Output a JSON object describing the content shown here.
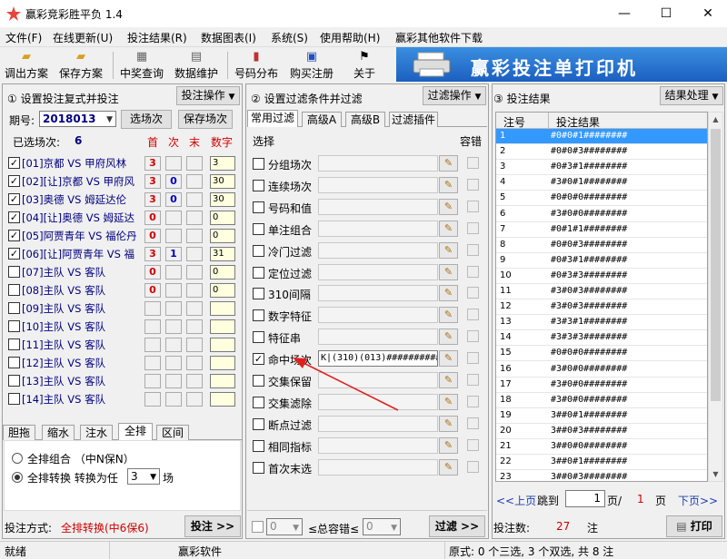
{
  "window": {
    "title": "赢彩竞彩胜平负 1.4",
    "minimize": "—",
    "maximize": "☐",
    "close": "✕"
  },
  "menu": [
    "文件(F)",
    "在线更新(U)",
    "投注结果(R)",
    "数据图表(I)",
    "系统(S)",
    "使用帮助(H)",
    "赢彩其他软件下载"
  ],
  "toolbar": [
    "调出方案",
    "保存方案",
    "中奖查询",
    "数据维护",
    "号码分布",
    "购买注册",
    "关于"
  ],
  "banner": "赢彩投注单打印机",
  "left": {
    "header": "① 设置投注复式并投注",
    "op_button": "投注操作",
    "period_label": "期号:",
    "period_value": "2018013",
    "select_btn": "选场次",
    "save_btn": "保存场次",
    "selected_label": "已选场次:",
    "selected_count": "6",
    "col_first": "首",
    "col_second": "次",
    "col_last": "末",
    "col_num": "数字",
    "matches": [
      {
        "label": "[01]京都 VS 甲府风林",
        "checked": true,
        "first": "3",
        "second": "",
        "last": "",
        "num": "3"
      },
      {
        "label": "[02][让]京都 VS 甲府风",
        "checked": true,
        "first": "3",
        "second": "0",
        "last": "",
        "num": "30"
      },
      {
        "label": "[03]奥德 VS 姆延达伦",
        "checked": true,
        "first": "3",
        "second": "0",
        "last": "",
        "num": "30"
      },
      {
        "label": "[04][让]奥德 VS 姆延达",
        "checked": true,
        "first": "0",
        "second": "",
        "last": "",
        "num": "0"
      },
      {
        "label": "[05]阿贾青年 VS 福伦丹",
        "checked": true,
        "first": "0",
        "second": "",
        "last": "",
        "num": "0"
      },
      {
        "label": "[06][让]阿贾青年 VS 福",
        "checked": true,
        "first": "3",
        "second": "1",
        "last": "",
        "num": "31"
      },
      {
        "label": "[07]主队 VS 客队",
        "checked": false,
        "first": "0",
        "second": "",
        "last": "",
        "num": "0"
      },
      {
        "label": "[08]主队 VS 客队",
        "checked": false,
        "first": "0",
        "second": "",
        "last": "",
        "num": "0"
      },
      {
        "label": "[09]主队 VS 客队",
        "checked": false,
        "first": "",
        "second": "",
        "last": "",
        "num": ""
      },
      {
        "label": "[10]主队 VS 客队",
        "checked": false,
        "first": "",
        "second": "",
        "last": "",
        "num": ""
      },
      {
        "label": "[11]主队 VS 客队",
        "checked": false,
        "first": "",
        "second": "",
        "last": "",
        "num": ""
      },
      {
        "label": "[12]主队 VS 客队",
        "checked": false,
        "first": "",
        "second": "",
        "last": "",
        "num": ""
      },
      {
        "label": "[13]主队 VS 客队",
        "checked": false,
        "first": "",
        "second": "",
        "last": "",
        "num": ""
      },
      {
        "label": "[14]主队 VS 客队",
        "checked": false,
        "first": "",
        "second": "",
        "last": "",
        "num": ""
      }
    ],
    "bottom_tabs": [
      "胆拖",
      "缩水",
      "注水",
      "全排",
      "区间"
    ],
    "radio1": "全排组合 （中N保N）",
    "radio2": "全排转换 转换为任",
    "radio2_value": "3",
    "radio2_suffix": "场",
    "mode_label": "投注方式:",
    "mode_value": "全排转换(中6保6)",
    "submit_btn": "投注 >>"
  },
  "mid": {
    "header": "② 设置过滤条件并过滤",
    "op_button": "过滤操作",
    "tabs": [
      "常用过滤",
      "高级A",
      "高级B",
      "过滤插件"
    ],
    "col_select": "选择",
    "col_tolerance": "容错",
    "filters": [
      {
        "label": "分组场次",
        "checked": false,
        "value": ""
      },
      {
        "label": "连续场次",
        "checked": false,
        "value": ""
      },
      {
        "label": "号码和值",
        "checked": false,
        "value": ""
      },
      {
        "label": "单注组合",
        "checked": false,
        "value": ""
      },
      {
        "label": "冷门过滤",
        "checked": false,
        "value": ""
      },
      {
        "label": "定位过滤",
        "checked": false,
        "value": ""
      },
      {
        "label": "310间隔",
        "checked": false,
        "value": ""
      },
      {
        "label": "数字特征",
        "checked": false,
        "value": ""
      },
      {
        "label": "特征串",
        "checked": false,
        "value": ""
      },
      {
        "label": "命中场次",
        "checked": true,
        "value": "K|(310)(013)##########"
      },
      {
        "label": "交集保留",
        "checked": false,
        "value": ""
      },
      {
        "label": "交集滤除",
        "checked": false,
        "value": ""
      },
      {
        "label": "断点过滤",
        "checked": false,
        "value": ""
      },
      {
        "label": "相同指标",
        "checked": false,
        "value": ""
      },
      {
        "label": "首次末选",
        "checked": false,
        "value": ""
      }
    ],
    "min_value": "0",
    "tol_label": "≤总容错≤",
    "max_value": "0",
    "filter_btn": "过滤 >>"
  },
  "right": {
    "header": "③ 投注结果",
    "op_button": "结果处理",
    "col_no": "注号",
    "col_result": "投注结果",
    "rows": [
      [
        "1",
        "#0#0#1########"
      ],
      [
        "2",
        "#0#0#3########"
      ],
      [
        "3",
        "#0#3#1########"
      ],
      [
        "4",
        "#3#0#1########"
      ],
      [
        "5",
        "#0#0#0########"
      ],
      [
        "6",
        "#3#0#0########"
      ],
      [
        "7",
        "#0#1#1########"
      ],
      [
        "8",
        "#0#0#3########"
      ],
      [
        "9",
        "#0#3#1########"
      ],
      [
        "10",
        "#0#3#3########"
      ],
      [
        "11",
        "#3#0#3########"
      ],
      [
        "12",
        "#3#0#3########"
      ],
      [
        "13",
        "#3#3#1########"
      ],
      [
        "14",
        "#3#3#3########"
      ],
      [
        "15",
        "#0#0#0########"
      ],
      [
        "16",
        "#3#0#0########"
      ],
      [
        "17",
        "#3#0#0########"
      ],
      [
        "18",
        "#3#0#0########"
      ],
      [
        "19",
        "3##0#1########"
      ],
      [
        "20",
        "3##0#3########"
      ],
      [
        "21",
        "3##0#0########"
      ],
      [
        "22",
        "3##0#1########"
      ],
      [
        "23",
        "3##0#3########"
      ]
    ],
    "prev_btn": "<<上页",
    "jump_label": "跳到",
    "page_value": "1",
    "page_sep": "页/",
    "page_total": "1",
    "page_unit": "页",
    "next_btn": "下页>>",
    "count_label": "投注数:",
    "count_value": "27",
    "count_unit": "注",
    "print_btn": "打印"
  },
  "status": {
    "ready": "就绪",
    "app": "赢彩软件",
    "info": "原式: 0 个三选, 3 个双选, 共 8 注"
  }
}
